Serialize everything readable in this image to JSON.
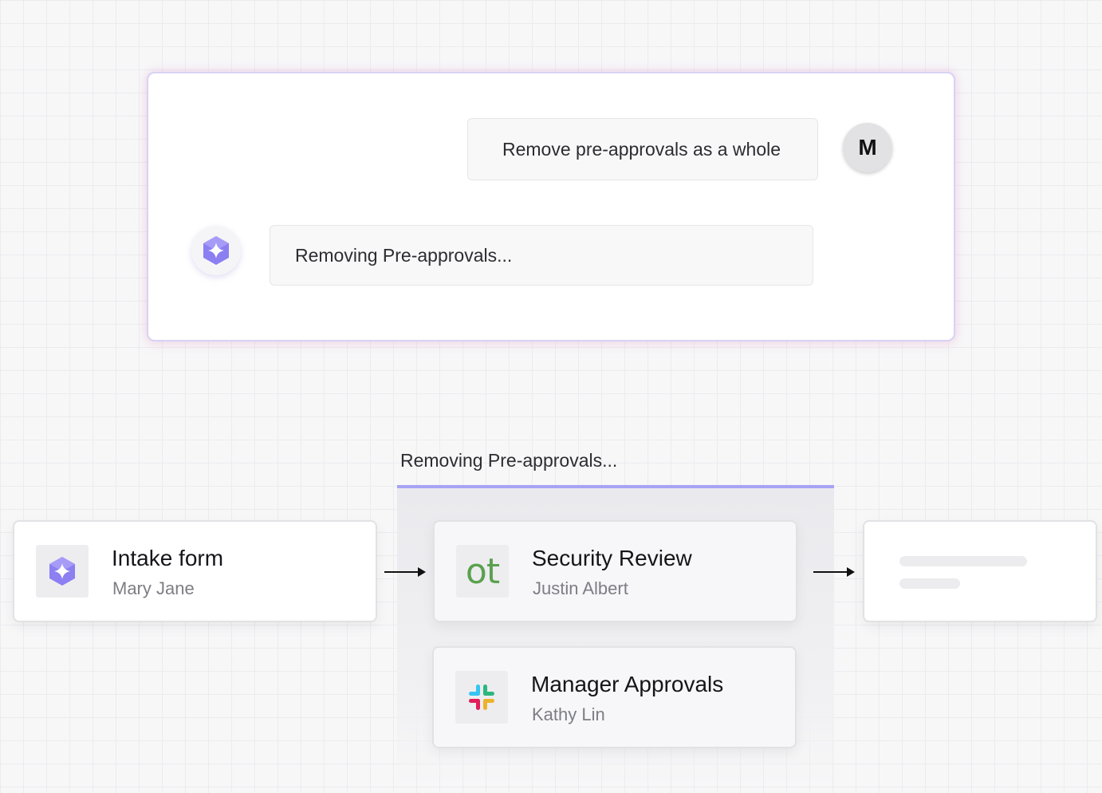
{
  "chat": {
    "user_message": "Remove pre-approvals as a whole",
    "user_avatar_initial": "M",
    "ai_message": "Removing Pre-approvals..."
  },
  "workflow": {
    "stage_label": "Removing Pre-approvals...",
    "nodes": [
      {
        "title": "Intake form",
        "subtitle": "Mary Jane",
        "icon": "ai-sparkle-icon"
      },
      {
        "title": "Security Review",
        "subtitle": "Justin Albert",
        "icon": "ot-logo-icon",
        "icon_text": "ot"
      },
      {
        "title": "Manager Approvals",
        "subtitle": "Kathy Lin",
        "icon": "slack-icon"
      }
    ]
  },
  "colors": {
    "accent": "#a7a3f4",
    "ai_icon": "#8b7ff2",
    "ot_logo": "#5aa14e"
  }
}
